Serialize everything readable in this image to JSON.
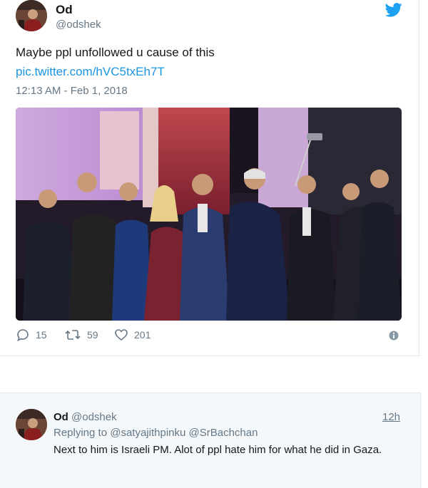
{
  "tweet": {
    "display_name": "Od",
    "handle": "@odshek",
    "text": "Maybe ppl unfollowed u cause of this",
    "link": "pic.twitter.com/hVC5txEh7T",
    "timestamp": "12:13 AM - Feb 1, 2018",
    "replies": "15",
    "retweets": "59",
    "likes": "201",
    "icons": [
      "twitter-bird-icon",
      "reply-icon",
      "retweet-icon",
      "like-icon",
      "info-icon"
    ]
  },
  "reply": {
    "display_name": "Od",
    "handle": "@odshek",
    "time": "12h",
    "replying_prefix": "Replying to",
    "replying_to": "@satyajithpinku @SrBachchan",
    "text": "Next to him is Israeli PM. Alot of ppl hate him for what he did in Gaza."
  },
  "colors": {
    "link": "#1b95e0",
    "twitter_blue": "#1da1f2",
    "muted": "#657786",
    "reply_bg": "#f5f8fa"
  }
}
